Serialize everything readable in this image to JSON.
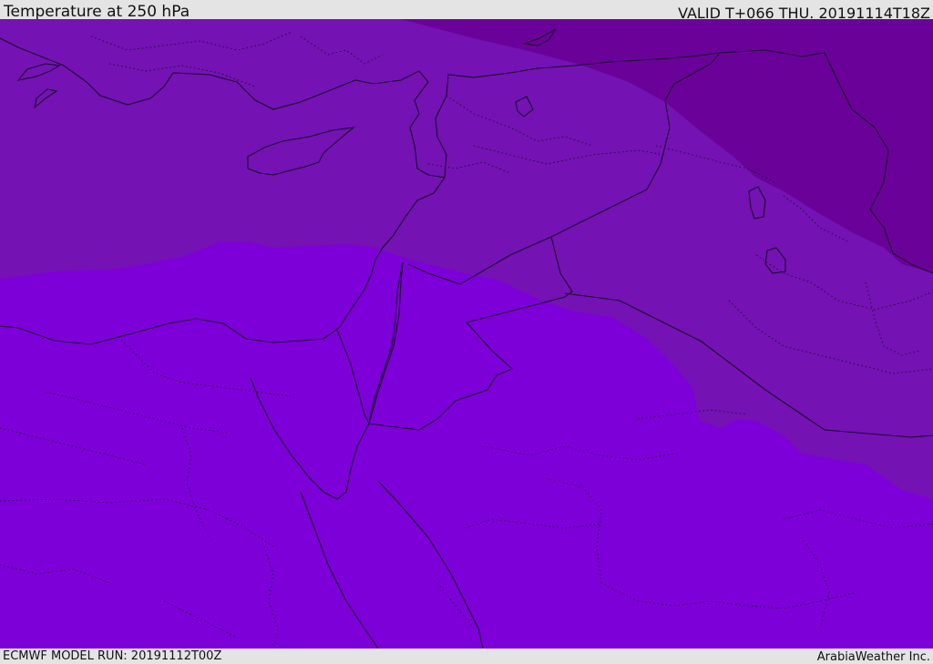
{
  "header": {
    "title": "Temperature at 250 hPa",
    "valid": "VALID T+066 THU. 20191114T18Z"
  },
  "footer": {
    "model_run": "ECMWF MODEL RUN: 20191112T00Z",
    "credit": "ArabiaWeather Inc."
  },
  "map": {
    "colors": {
      "warm_zone": "#7d00d8",
      "mid_zone": "#7412b4",
      "cold_zone": "#6a0299",
      "coastline": "#1a0b2a"
    }
  }
}
